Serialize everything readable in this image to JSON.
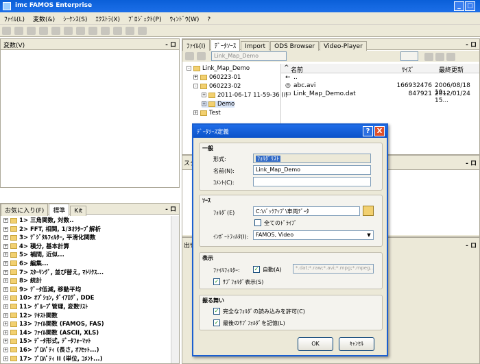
{
  "window": {
    "title": "imc FAMOS Enterprise"
  },
  "menu": [
    "ﾌｧｲﾙ(L)",
    "変数(&)",
    "ｼｰｹﾝｽ(S)",
    "ｴｸｽﾄﾗ(X)",
    "ﾌﾟﾛｼﾞｪｸﾄ(P)",
    "ｳｨﾝﾄﾞｳ(W)",
    "?"
  ],
  "left_top": {
    "title": "変数(V)",
    "pin": "- ロ"
  },
  "favorites": {
    "tabs": [
      "お気に入り(F)",
      "標準",
      "Kit"
    ],
    "pin": "- ロ",
    "items": [
      "1> 三角関数, 対数..",
      "2> FFT, 相関, 1/3ｵｸﾀｰﾌﾞ解析",
      "3> ﾃﾞｼﾞﾀﾙﾌｨﾙﾀｰ, 平滑化関数",
      "4> 積分, 基本計算",
      "5> 補間, 近似...",
      "6> 編集...",
      "7> ｽﾀｰﾘﾝｸﾞ, 並び替え, ﾏﾄﾘｸｽ...",
      "8> 統計",
      "9> ﾃﾞｰﾀ低減, 移動平均",
      "10> ｵﾌﾟｼｮﾝ, ﾀﾞｲｱﾛｸﾞ, DDE",
      "11> ｸﾞﾙｰﾌﾟ管理, 変数ﾘｽﾄ",
      "12> ﾃｷｽﾄ関数",
      "13> ﾌｧｲﾙ関数 (FAMOS, FAS)",
      "14> ﾌｧｲﾙ関数 (ASCII, XLS)",
      "15> ﾃﾞｰﾀ形式, ﾃﾞｰﾀﾌｫｰﾏｯﾄ",
      "16> ﾌﾟﾛﾊﾟﾃｨ (長さ, ｵﾌｾｯﾄ...)",
      "17> ﾌﾟﾛﾊﾟﾃｨ II (単位, ｺﾒﾝﾄ...)"
    ]
  },
  "right_top": {
    "tabs": [
      "ﾌｧｲﾙ(I)",
      "ﾃﾞｰﾀｿｰｽ",
      "Import",
      "ODS Browser",
      "Video-Player"
    ],
    "pin": "- ロ",
    "source_field": "Link_Map_Demo",
    "tree": [
      "Link_Map_Demo",
      "060223-01",
      "060223-02",
      "2011-06-17 11-59-36 (i)",
      "Demo",
      "Test"
    ],
    "columns": [
      "名前",
      "ｻｲｽﾞ",
      "最終更新"
    ],
    "files": [
      {
        "name": "..",
        "size": "",
        "date": ""
      },
      {
        "name": "abc.avi",
        "size": "166932476",
        "date": "2006/08/18 19..."
      },
      {
        "name": "Link_Map_Demo.dat",
        "size": "847921",
        "date": "2012/01/24 15..."
      }
    ]
  },
  "mid_pane": {
    "title_fragment": "スク",
    "pin": "- ロ"
  },
  "bot_pane": {
    "title_fragment": "出ｻ",
    "pin": "- ロ"
  },
  "dialog": {
    "title": "ﾃﾞｰﾀｿｰｽ定義",
    "help": "?",
    "close": "X",
    "general": {
      "label": "一般",
      "format_label": "形式:",
      "format_value": "ﾌｫﾙﾀﾞﾘｽﾄ",
      "name_label": "名前(N):",
      "name_value": "Link_Map_Demo",
      "comment_label": "ｺﾒﾝﾄ(C):",
      "comment_value": ""
    },
    "source": {
      "label": "ｿｰｽ",
      "folder_label": "ﾌｫﾙﾀﾞ(E)",
      "folder_value": "C:\\ﾊﾞｯｸｱｯﾌﾟ\\車両ﾃﾞｰﾀ",
      "all_drives": "全てのﾄﾞﾗｲﾌﾞ",
      "filter_label": "ｲﾝﾎﾟｰﾄﾌｨﾙﾀ(I):",
      "filter_value": "FAMOS, Video"
    },
    "display": {
      "label": "表示",
      "file_filter_label": "ﾌｧｲﾙﾌｨﾙﾀｰ:",
      "auto_label": "自動(A)",
      "filter_pattern": "*.dat;*.raw;*.avi;*.mpg;*.mpeg...",
      "show_subfolders": "ｻﾌﾞﾌｫﾙﾀﾞ表示(S)"
    },
    "behavior": {
      "label": "振る舞い",
      "allow_full": "完全なﾌｫﾙﾀﾞの読み込みを許可(C)",
      "remember_last": "最後のｻﾌﾞﾌｫﾙﾀﾞを記憶(L)"
    },
    "ok": "OK",
    "cancel": "ｷｬﾝｾﾙ"
  }
}
